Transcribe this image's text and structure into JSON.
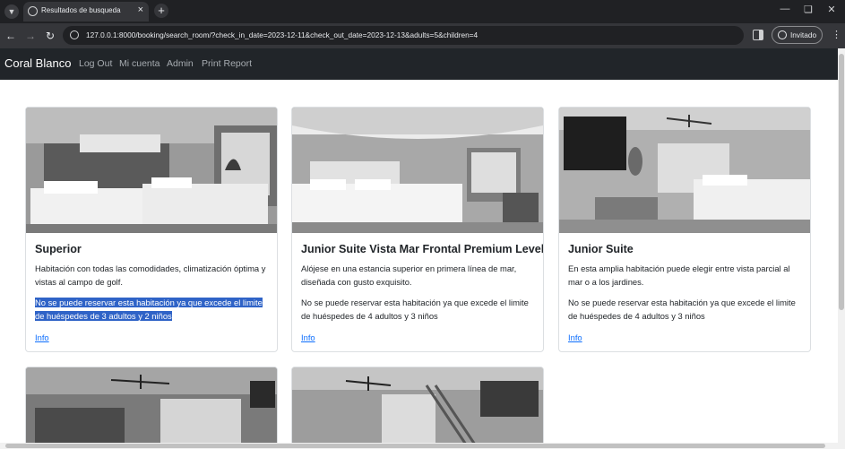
{
  "browser": {
    "tab_title": "Resultados de busqueda",
    "url": "127.0.0.1:8000/booking/search_room/?check_in_date=2023-12-11&check_out_date=2023-12-13&adults=5&children=4",
    "profile_label": "Invitado"
  },
  "navbar": {
    "brand": "Coral Blanco",
    "links": [
      "Log Out",
      "Mi cuenta",
      "Admin",
      "Print Report"
    ]
  },
  "rooms": [
    {
      "name": "Superior",
      "description": "Habitación con todas las comodidades, climatización óptima y vistas al campo de golf.",
      "warning": "No se puede reservar esta habitación ya que excede el limite de huéspedes de 3 adultos y 2 niños",
      "link": "Info",
      "warning_selected": true
    },
    {
      "name": "Junior Suite Vista Mar Frontal Premium Level",
      "description": "Alójese en una estancia superior en primera línea de mar, diseñada con gusto exquisito.",
      "warning": "No se puede reservar esta habitación ya que excede el limite de huéspedes de 4 adultos y 3 niños",
      "link": "Info",
      "warning_selected": false
    },
    {
      "name": "Junior Suite",
      "description": "En esta amplia habitación puede elegir entre vista parcial al mar o a los jardines.",
      "warning": "No se puede reservar esta habitación ya que excede el limite de huéspedes de 4 adultos y 3 niños",
      "link": "Info",
      "warning_selected": false
    }
  ],
  "colors": {
    "navbar_bg": "#212529",
    "link": "#0d6efd",
    "selection": "#2f63c7"
  }
}
